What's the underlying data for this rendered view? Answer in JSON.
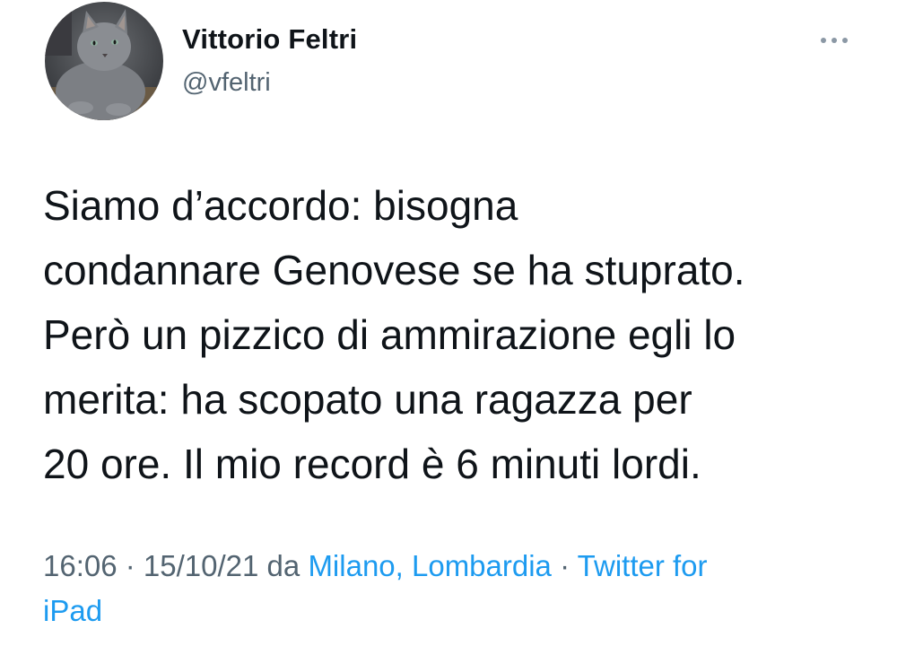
{
  "author": {
    "display_name": "Vittorio Feltri",
    "handle": "@vfeltri",
    "avatar_icon": "cat-avatar-photo"
  },
  "more_menu": {
    "icon": "more-horizontal-icon"
  },
  "tweet": {
    "text_lines": [
      "Siamo d’accordo: bisogna",
      "condannare Genovese se ha stuprato.",
      "Però un pizzico di ammirazione egli lo",
      "merita: ha scopato una ragazza per",
      "20 ore. Il mio record è  6 minuti lordi."
    ]
  },
  "meta": {
    "time": "16:06",
    "separator": " · ",
    "date": "15/10/21",
    "from_label": " da ",
    "location": "Milano, Lombardia",
    "separator2": " · ",
    "source_line1": "Twitter for",
    "source_line2": "iPad"
  },
  "colors": {
    "link": "#1d9bf0",
    "secondary": "#536471",
    "text": "#0f1419"
  }
}
